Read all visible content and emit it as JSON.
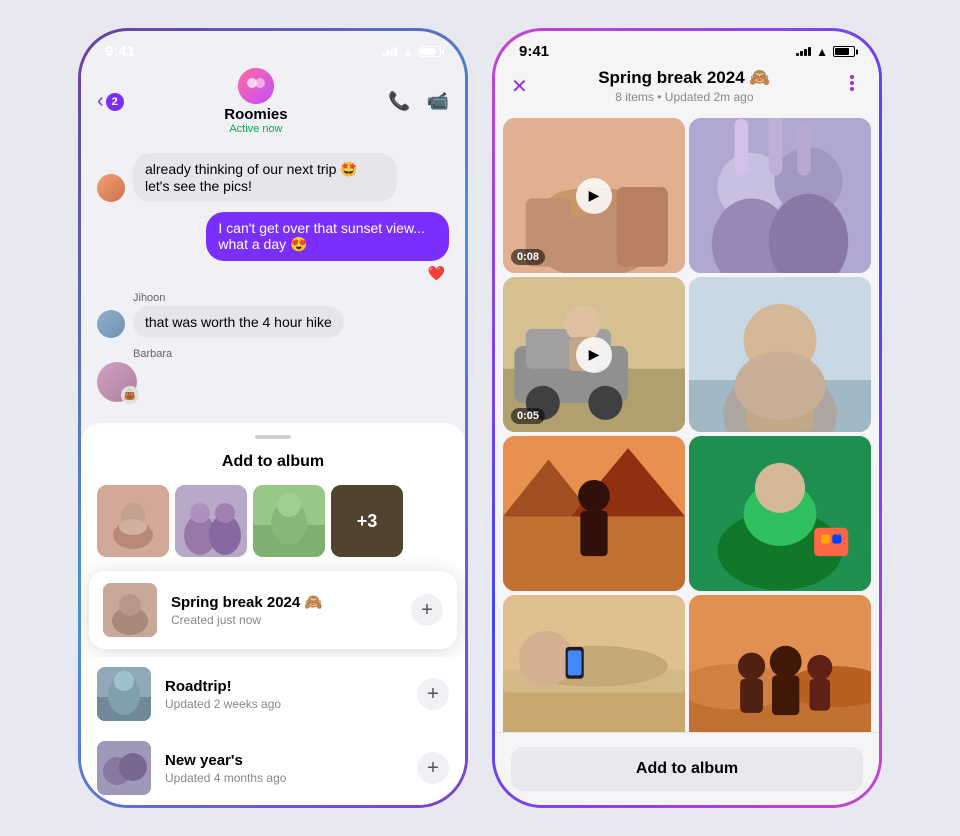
{
  "left_phone": {
    "status_bar": {
      "time": "9:41",
      "signal": 4,
      "wifi": true,
      "battery": 75
    },
    "header": {
      "back_label": "2",
      "chat_name": "Roomies",
      "chat_status": "Active now",
      "call_icon": "📞",
      "video_icon": "📹"
    },
    "messages": [
      {
        "sender": null,
        "text": "already thinking of our next trip 🤩 let's see the pics!",
        "type": "incoming",
        "sender_name": null,
        "avatar": true
      },
      {
        "sender": "self",
        "text": "I can't get over that sunset view... what a day 😍",
        "type": "outgoing",
        "reaction": "❤️"
      },
      {
        "sender": "Jihoon",
        "text": "that was worth the 4 hour hike",
        "type": "incoming",
        "avatar": true
      },
      {
        "sender": "Barbara",
        "type": "incoming",
        "text": "",
        "avatar": true
      }
    ],
    "sheet": {
      "handle": true,
      "title": "Add to album",
      "photo_count_extra": "+3",
      "albums": [
        {
          "name": "Spring break 2024 🙈",
          "meta": "Created just now",
          "highlighted": true
        },
        {
          "name": "Roadtrip!",
          "meta": "Updated 2 weeks ago",
          "highlighted": false
        },
        {
          "name": "New year's",
          "meta": "Updated 4 months ago",
          "highlighted": false
        }
      ]
    }
  },
  "right_phone": {
    "status_bar": {
      "time": "9:41",
      "signal": 4,
      "wifi": true,
      "battery": 75
    },
    "header": {
      "close_icon": "✕",
      "title": "Spring break 2024 🙈",
      "subtitle": "8 items • Updated 2m ago",
      "more_icon": "⋯"
    },
    "photos": [
      {
        "type": "video",
        "duration": "0:08",
        "scene": "scene-1"
      },
      {
        "type": "photo",
        "scene": "scene-2"
      },
      {
        "type": "video",
        "duration": "0:05",
        "scene": "scene-3"
      },
      {
        "type": "photo",
        "scene": "scene-4"
      },
      {
        "type": "photo",
        "scene": "scene-5"
      },
      {
        "type": "photo",
        "scene": "scene-6"
      },
      {
        "type": "photo",
        "scene": "scene-7"
      },
      {
        "type": "photo",
        "scene": "scene-8"
      }
    ],
    "footer": {
      "add_label": "Add to album"
    }
  }
}
